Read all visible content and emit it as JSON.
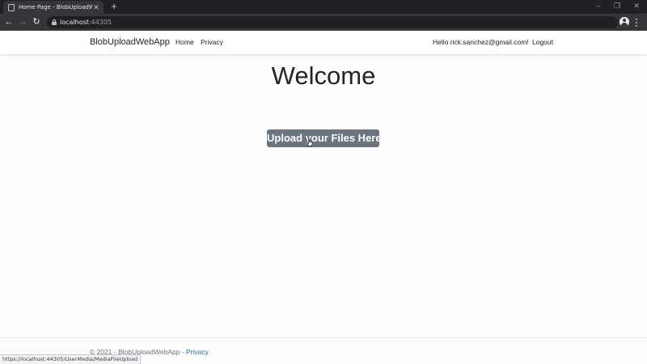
{
  "browser": {
    "tab_title": "Home Page - BlobUploadWebApp",
    "tab_close": "✕",
    "new_tab": "+",
    "url_host": "localhost",
    "url_port": ":44305",
    "back_glyph": "←",
    "forward_glyph": "→",
    "reload_glyph": "↻",
    "star_glyph": "☆",
    "minimize_glyph": "–",
    "restore_glyph": "❐",
    "close_glyph": "✕",
    "status_url": "https://localhost:44305/UserMedia/MediaFileUpload"
  },
  "navbar": {
    "brand": "BlobUploadWebApp",
    "links": [
      "Home",
      "Privacy"
    ],
    "greeting": "Hello rick.sanchez@gmail.com!",
    "logout": "Logout"
  },
  "main": {
    "heading": "Welcome",
    "upload_button": "Upload your Files Here"
  },
  "footer": {
    "copyright": "© 2021 - BlobUploadWebApp - ",
    "privacy_link": "Privacy"
  },
  "colors": {
    "button_bg": "#6c757d",
    "link": "#1b6ec2",
    "chrome_dark": "#202124",
    "chrome_toolbar": "#35363a"
  }
}
